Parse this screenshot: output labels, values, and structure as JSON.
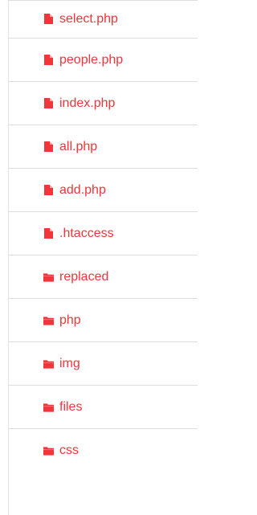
{
  "accent_color": "#f0353b",
  "files": [
    {
      "name": "select.php",
      "icon": "file-icon"
    },
    {
      "name": "people.php",
      "icon": "file-icon"
    },
    {
      "name": "index.php",
      "icon": "file-icon"
    },
    {
      "name": "all.php",
      "icon": "file-icon"
    },
    {
      "name": "add.php",
      "icon": "file-icon"
    },
    {
      "name": ".htaccess",
      "icon": "file-icon"
    },
    {
      "name": "replaced",
      "icon": "folder-icon"
    },
    {
      "name": "php",
      "icon": "folder-icon"
    },
    {
      "name": "img",
      "icon": "folder-icon"
    },
    {
      "name": "files",
      "icon": "folder-icon"
    },
    {
      "name": "css",
      "icon": "folder-icon"
    }
  ]
}
